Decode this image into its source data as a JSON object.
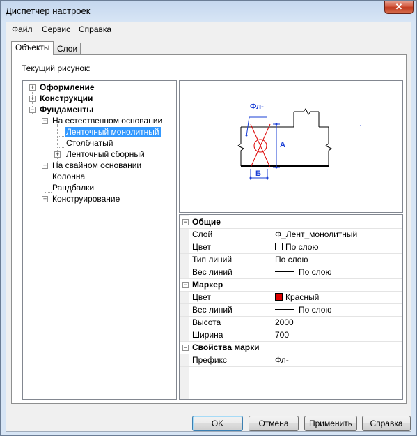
{
  "window": {
    "title": "Диспетчер настроек",
    "close_label": "✕"
  },
  "menu": {
    "items": [
      "Файл",
      "Сервис",
      "Справка"
    ]
  },
  "tabs": [
    "Объекты",
    "Слои"
  ],
  "current_drawing_label": "Текущий рисунок:",
  "tree": {
    "items": [
      {
        "label": "Оформление",
        "expander": "+"
      },
      {
        "label": "Конструкции",
        "expander": "+"
      },
      {
        "label": "Фундаменты",
        "expander": "−"
      },
      {
        "label": "На естественном основании",
        "expander": "−"
      },
      {
        "label": "Ленточный монолитный"
      },
      {
        "label": "Столбчатый"
      },
      {
        "label": "Ленточный сборный",
        "expander": "+"
      },
      {
        "label": "На свайном основании",
        "expander": "+"
      },
      {
        "label": "Колонна"
      },
      {
        "label": "Рандбалки"
      },
      {
        "label": "Конструирование",
        "expander": "+"
      }
    ]
  },
  "preview": {
    "label_fl": "Фл-",
    "label_a": "А",
    "label_b": "Б"
  },
  "properties": {
    "general": {
      "title": "Общие",
      "rows": [
        {
          "name": "Слой",
          "value": "Ф_Лент_монолитный"
        },
        {
          "name": "Цвет",
          "value": "По слою"
        },
        {
          "name": "Тип линий",
          "value": "По слою"
        },
        {
          "name": "Вес линий",
          "value": "По слою"
        }
      ]
    },
    "marker": {
      "title": "Маркер",
      "rows": [
        {
          "name": "Цвет",
          "value": "Красный"
        },
        {
          "name": "Вес линий",
          "value": "По слою"
        },
        {
          "name": "Высота",
          "value": "2000"
        },
        {
          "name": "Ширина",
          "value": "700"
        }
      ]
    },
    "mark": {
      "title": "Свойства марки",
      "rows": [
        {
          "name": "Префикс",
          "value": "Фл-"
        }
      ]
    },
    "toggle": "−"
  },
  "colors": {
    "selection": "#3399ff",
    "marker_red": "#dd0000",
    "preview_blue": "#1a3fd6"
  },
  "buttons": {
    "ok": "OK",
    "cancel": "Отмена",
    "apply": "Применить",
    "help": "Справка"
  }
}
